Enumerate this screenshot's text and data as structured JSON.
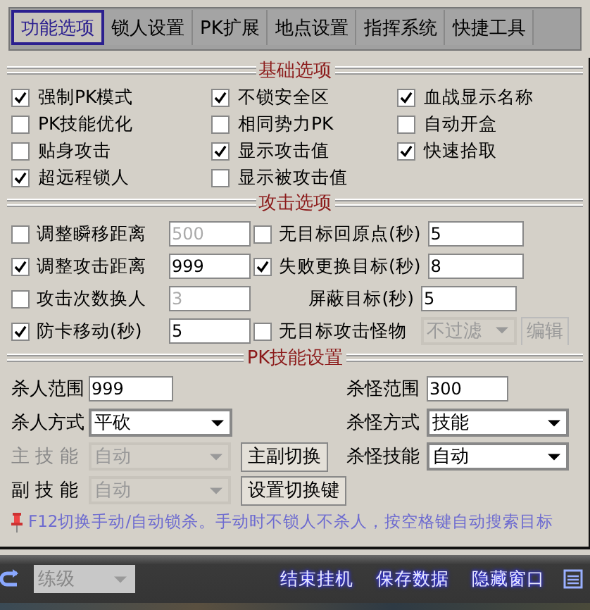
{
  "tabs": [
    {
      "label": "功能选项",
      "selected": true
    },
    {
      "label": "锁人设置",
      "selected": false
    },
    {
      "label": "PK扩展",
      "selected": false
    },
    {
      "label": "地点设置",
      "selected": false
    },
    {
      "label": "指挥系统",
      "selected": false
    },
    {
      "label": "快捷工具",
      "selected": false
    }
  ],
  "basic": {
    "title": "基础选项",
    "options": [
      {
        "label": "强制PK模式",
        "checked": true
      },
      {
        "label": "不锁安全区",
        "checked": true
      },
      {
        "label": "血战显示名称",
        "checked": true
      },
      {
        "label": "PK技能优化",
        "checked": false
      },
      {
        "label": "相同势力PK",
        "checked": false
      },
      {
        "label": "自动开盒",
        "checked": false
      },
      {
        "label": "贴身攻击",
        "checked": false
      },
      {
        "label": "显示攻击值",
        "checked": true
      },
      {
        "label": "快速拾取",
        "checked": true
      },
      {
        "label": "超远程锁人",
        "checked": true
      },
      {
        "label": "显示被攻击值",
        "checked": false
      }
    ]
  },
  "attack": {
    "title": "攻击选项",
    "items": [
      {
        "kind": "check-input",
        "label": "调整瞬移距离",
        "checked": false,
        "value": "500",
        "disabled": true
      },
      {
        "kind": "check-input",
        "label": "无目标回原点(秒)",
        "checked": false,
        "value": "5",
        "disabled": false
      },
      {
        "kind": "check-input",
        "label": "调整攻击距离",
        "checked": true,
        "value": "999",
        "disabled": false
      },
      {
        "kind": "check-input",
        "label": "失败更换目标(秒)",
        "checked": true,
        "value": "8",
        "disabled": false
      },
      {
        "kind": "check-input",
        "label": "攻击次数换人",
        "checked": false,
        "value": "3",
        "disabled": true
      },
      {
        "kind": "label-input",
        "label": "屏蔽目标(秒)",
        "value": "5",
        "disabled": false
      },
      {
        "kind": "check-input",
        "label": "防卡移动(秒)",
        "checked": true,
        "value": "5",
        "disabled": false
      },
      {
        "kind": "check-select",
        "label": "无目标攻击怪物",
        "checked": false,
        "value": "不过滤",
        "disabled": true,
        "button": "编辑"
      }
    ]
  },
  "pk": {
    "title": "PK技能设置",
    "items": [
      {
        "kind": "input",
        "label": "杀人范围",
        "value": "999",
        "disabled": false,
        "label_disabled": false
      },
      {
        "kind": "input",
        "label": "杀怪范围",
        "value": "300",
        "disabled": false,
        "label_disabled": false
      },
      {
        "kind": "select",
        "label": "杀人方式",
        "value": "平砍",
        "disabled": false,
        "label_disabled": false
      },
      {
        "kind": "select",
        "label": "杀怪方式",
        "value": "技能",
        "disabled": false,
        "label_disabled": false
      },
      {
        "kind": "select-button",
        "label": "主 技 能",
        "value": "自动",
        "disabled": true,
        "label_disabled": true,
        "button": "主副切换"
      },
      {
        "kind": "select",
        "label": "杀怪技能",
        "value": "自动",
        "disabled": false,
        "label_disabled": false
      },
      {
        "kind": "select-button",
        "label": "副 技 能",
        "value": "自动",
        "disabled": true,
        "label_disabled": false,
        "button": "设置切换键"
      }
    ]
  },
  "note": "F12切换手动/自动锁杀。手动时不锁人不杀人，按空格键自动搜索目标",
  "bottom_bar": {
    "mode": {
      "value": "练级",
      "disabled": true
    },
    "buttons": [
      "结束挂机",
      "保存数据",
      "隐藏窗口"
    ]
  }
}
